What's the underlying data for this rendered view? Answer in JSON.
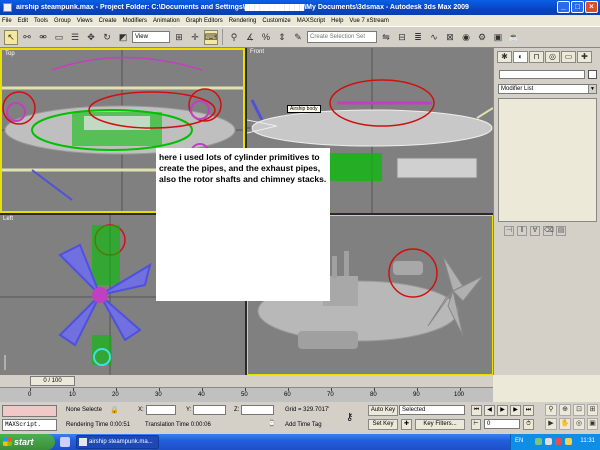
{
  "window": {
    "title": "airship steampunk.max    - Project Folder: C:\\Documents and Settings\\████████████\\My Documents\\3dsmax    - Autodesk 3ds Max  2009"
  },
  "menu": [
    "File",
    "Edit",
    "Tools",
    "Group",
    "Views",
    "Create",
    "Modifiers",
    "Animation",
    "Graph Editors",
    "Rendering",
    "Customize",
    "MAXScript",
    "Help",
    "Vue 7 xStream"
  ],
  "toolbar": {
    "view_dropdown": "View",
    "selection_set": "Create Selection Set"
  },
  "viewports": {
    "top": "Top",
    "front": "Front",
    "left": "Left",
    "perspective": ""
  },
  "airship_label": "Airship body",
  "note": "here i used lots of cylinder primitives to create the pipes, and the exhaust pipes, also the rotor shafts and chimney stacks.",
  "command_panel": {
    "modifier_list": "Modifier List"
  },
  "time": {
    "slider": "0 / 100",
    "ticks": [
      "0",
      "10",
      "20",
      "30",
      "40",
      "50",
      "60",
      "70",
      "80",
      "90",
      "100"
    ]
  },
  "status": {
    "selection": "None Selecte",
    "x_label": "X:",
    "y_label": "Y:",
    "z_label": "Z:",
    "grid": "Grid = 329.7017'",
    "auto_key": "Auto Key",
    "selected_option": "Selected",
    "set_key": "Set Key",
    "key_filters": "Key Filters...",
    "rendering_time": "Rendering Time  0:00:51",
    "translation_time": "Translation Time  0:00:06",
    "add_time_tag": "Add Time Tag",
    "maxscript": "MAXScript.",
    "frame": "0"
  },
  "taskbar": {
    "start": "start",
    "task": "airship steampunk.ma...",
    "language": "EN",
    "clock": "11:31"
  },
  "colors": {
    "viewport_bg": "#808080",
    "active_border": "#e8e000",
    "selection_green": "#00c000",
    "annotation_red": "#d01010"
  }
}
